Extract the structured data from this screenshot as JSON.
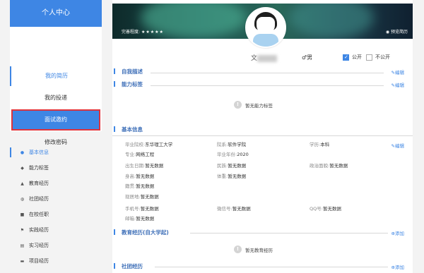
{
  "sidebar": {
    "title": "个人中心",
    "items": [
      {
        "label": "我的简历"
      },
      {
        "label": "我的投递"
      },
      {
        "label": "面试邀约"
      },
      {
        "label": "修改密码"
      }
    ]
  },
  "resume_nav": {
    "items": [
      {
        "label": "基本信息",
        "icon": "user-icon"
      },
      {
        "label": "能力标签",
        "icon": "tag-icon"
      },
      {
        "label": "教育经历",
        "icon": "graduation-cap-icon"
      },
      {
        "label": "社团经历",
        "icon": "group-icon"
      },
      {
        "label": "在校任职",
        "icon": "briefcase-icon"
      },
      {
        "label": "实践经历",
        "icon": "flag-icon"
      },
      {
        "label": "实习经历",
        "icon": "document-icon"
      },
      {
        "label": "项目经历",
        "icon": "folder-icon"
      }
    ]
  },
  "banner": {
    "completeness_label": "完善程度:",
    "stars": "★★★★★",
    "preview_label": "预览简历"
  },
  "profile": {
    "name_visible": "文",
    "gender": "男",
    "public_label": "公开",
    "private_label": "不公开",
    "public_checked": true
  },
  "sections": {
    "self_desc": {
      "title": "自我描述",
      "edit": "编辑"
    },
    "ability": {
      "title": "能力标签",
      "edit": "编辑",
      "empty": "暂无能力标签"
    },
    "basic": {
      "title": "基本信息",
      "edit": "编辑",
      "fields": {
        "school": {
          "label": "毕业院校:",
          "value": "东华理工大学"
        },
        "college": {
          "label": "院系:",
          "value": "软件学院"
        },
        "degree": {
          "label": "学历:",
          "value": "本科"
        },
        "major": {
          "label": "专业:",
          "value": "网络工程"
        },
        "grad_year": {
          "label": "毕业年份:",
          "value": "2020"
        },
        "birthday": {
          "label": "出生日期:",
          "value": "暂无数据"
        },
        "ethnicity": {
          "label": "民族:",
          "value": "暂无数据"
        },
        "politics": {
          "label": "政治面貌:",
          "value": "暂无数据"
        },
        "height": {
          "label": "身高:",
          "value": "暂无数据"
        },
        "weight": {
          "label": "体重:",
          "value": "暂无数据"
        },
        "hometown": {
          "label": "籍贯:",
          "value": "暂无数据"
        },
        "residence": {
          "label": "现居地:",
          "value": "暂无数据"
        },
        "phone": {
          "label": "手机号:",
          "value": "暂无数据"
        },
        "wechat": {
          "label": "微信号:",
          "value": "暂无数据"
        },
        "qq": {
          "label": "QQ号:",
          "value": "暂无数据"
        },
        "email": {
          "label": "邮箱:",
          "value": "暂无数据"
        }
      }
    },
    "education": {
      "title": "教育经历(自大学起)",
      "add": "添加",
      "empty": "暂无教育经历"
    },
    "club": {
      "title": "社团经历",
      "add": "添加"
    }
  },
  "colors": {
    "accent": "#3e86e4",
    "highlight_border": "#e0333a"
  }
}
